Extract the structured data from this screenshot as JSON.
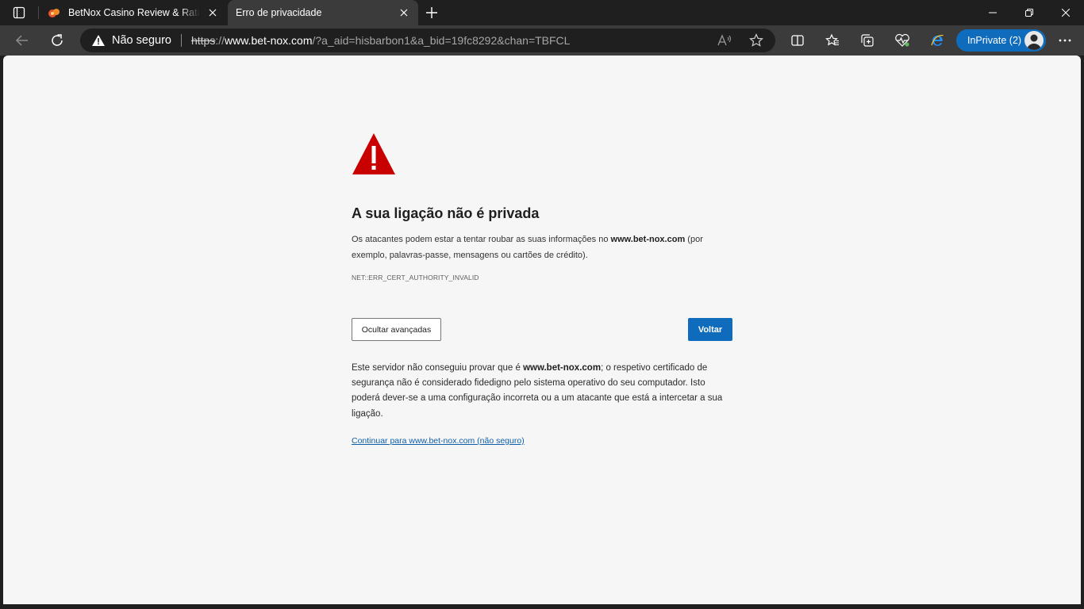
{
  "tabs": [
    {
      "title": "BetNox Casino Review & Ratings"
    },
    {
      "title": "Erro de privacidade"
    }
  ],
  "address_bar": {
    "security_label": "Não seguro",
    "url_scheme": "https",
    "url_sep": "://",
    "url_host": "www.bet-nox.com",
    "url_rest": "/?a_aid=hisbarbon1&a_bid=19fc8292&chan=TBFCL"
  },
  "inprivate": {
    "label": "InPrivate (2)"
  },
  "error_page": {
    "heading": "A sua ligação não é privada",
    "summary_before": "Os atacantes podem estar a tentar roubar as suas informações no ",
    "summary_host": "www.bet-nox.com",
    "summary_after": " (por exemplo, palavras-passe, mensagens ou cartões de crédito).",
    "error_code": "NET::ERR_CERT_AUTHORITY_INVALID",
    "advanced_button": "Ocultar avançadas",
    "back_button": "Voltar",
    "details_before": "Este servidor não conseguiu provar que é ",
    "details_host": "www.bet-nox.com",
    "details_after": "; o respetivo certificado de segurança não é considerado fidedigno pelo sistema operativo do seu computador. Isto poderá dever-se a uma configuração incorreta ou a um atacante que está a intercetar a sua ligação.",
    "proceed_link": "Continuar para www.bet-nox.com (não seguro)"
  },
  "colors": {
    "accent": "#0f6cbd",
    "warning_red": "#c80000",
    "chrome_dark": "#1f1f1f",
    "toolbar": "#3b3b3b",
    "page_bg": "#f6f6f6"
  },
  "icons": {
    "tab_actions": "tab-actions-icon",
    "favicon": "casino-favicon-icon",
    "tab_close": "close-icon",
    "new_tab": "plus-icon",
    "minimize": "minimize-icon",
    "restore": "restore-icon",
    "close_window": "close-icon",
    "back": "back-arrow-icon",
    "refresh": "refresh-icon",
    "not_secure": "warning-triangle-icon",
    "read_aloud": "read-aloud-icon",
    "favorite": "star-icon",
    "split_screen": "split-screen-icon",
    "favorites": "favorites-icon",
    "collections": "collections-icon",
    "browser_essentials": "heartbeat-icon",
    "ie_mode": "ie-mode-icon",
    "profile": "avatar",
    "menu": "more-icon",
    "error": "warning-triangle-icon"
  }
}
